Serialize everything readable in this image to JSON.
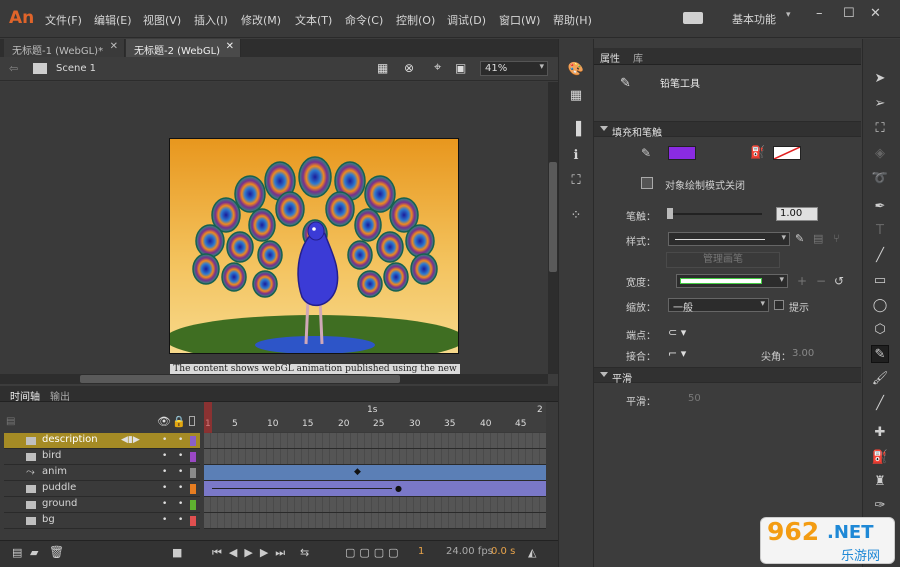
{
  "app": {
    "logo": "An"
  },
  "menu": [
    "文件(F)",
    "编辑(E)",
    "视图(V)",
    "插入(I)",
    "修改(M)",
    "文本(T)",
    "命令(C)",
    "控制(O)",
    "调试(D)",
    "窗口(W)",
    "帮助(H)"
  ],
  "workspace": {
    "label": "基本功能"
  },
  "doc_tabs": [
    {
      "label": "无标题-1 (WebGL)*"
    },
    {
      "label": "无标题-2 (WebGL)"
    }
  ],
  "editbar": {
    "scene": "Scene 1",
    "zoom": "41%"
  },
  "stage": {
    "caption": "The content shows webGL animation published using the new WebGL support"
  },
  "timeline": {
    "tabs": [
      "时间轴",
      "输出"
    ],
    "ruler_label": "1s",
    "ruler_numbers": [
      "1",
      "5",
      "10",
      "15",
      "20",
      "25",
      "30",
      "35",
      "40",
      "45"
    ],
    "ruler_end": "2",
    "layers": [
      {
        "name": "description",
        "color": "#8a60c9",
        "selected": true
      },
      {
        "name": "bird",
        "color": "#9a48c4"
      },
      {
        "name": "anim",
        "color": "#8b8b8b"
      },
      {
        "name": "puddle",
        "color": "#e67d21"
      },
      {
        "name": "ground",
        "color": "#5fb230"
      },
      {
        "name": "bg",
        "color": "#e05050"
      }
    ],
    "fps": "24.00 fps",
    "time": "0.0 s",
    "frame": "1"
  },
  "properties": {
    "tabs": [
      "属性",
      "库"
    ],
    "tool_name": "铅笔工具",
    "section_fill": "填充和笔触",
    "stroke_color": "#8a2be2",
    "object_draw": "对象绘制模式关闭",
    "stroke_label": "笔触：",
    "stroke_value": "1.00",
    "style_label": "样式：",
    "manage_label": "管理画笔",
    "width_label": "宽度：",
    "scale_label": "缩放：",
    "scale_value": "一般",
    "hint_label": "提示",
    "cap_label": "端点：",
    "join_label": "接合：",
    "miter_label": "尖角：",
    "miter_value": "3.00",
    "section_smooth": "平滑",
    "smooth_label": "平滑：",
    "smooth_value": "50"
  },
  "watermark": {
    "num": "962",
    "net": ".NET",
    "sub": "乐游网"
  }
}
